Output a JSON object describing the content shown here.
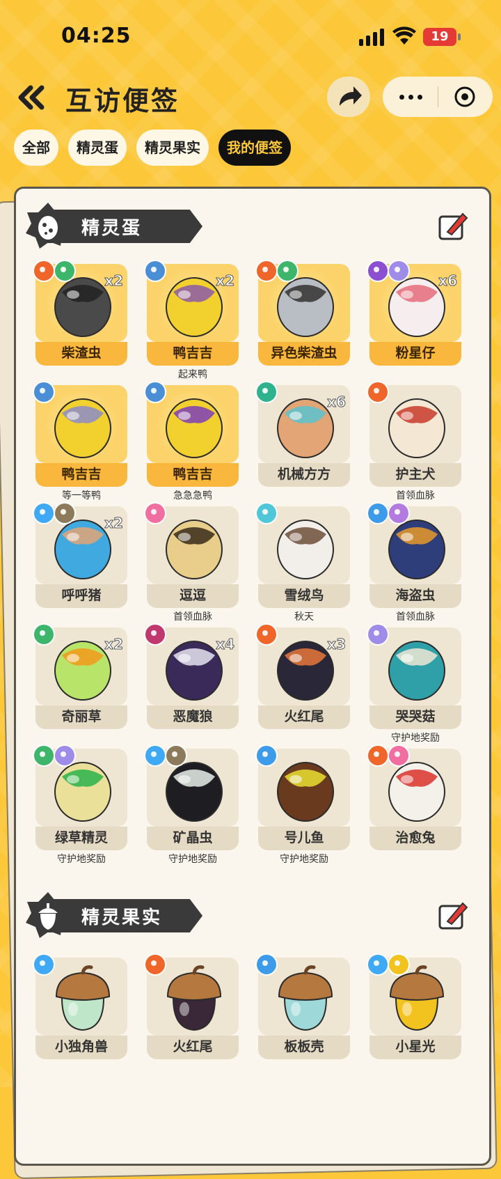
{
  "status": {
    "time": "04:25",
    "battery": "19"
  },
  "header": {
    "title": "互访便签"
  },
  "tabs": [
    {
      "label": "全部",
      "active": false
    },
    {
      "label": "精灵蛋",
      "active": false
    },
    {
      "label": "精灵果实",
      "active": false
    },
    {
      "label": "我的便签",
      "active": true
    }
  ],
  "eggs_section": {
    "title": "精灵蛋",
    "items": [
      {
        "name": "柴渣虫",
        "count": "x2",
        "sub": "",
        "gold": true,
        "badges": [
          "fire",
          "grass"
        ],
        "egg": [
          "#4a4a4a",
          "#222"
        ]
      },
      {
        "name": "鸭吉吉",
        "count": "x2",
        "sub": "起来鸭",
        "gold": true,
        "badges": [
          "normal"
        ],
        "egg": [
          "#F2D02E",
          "#8C5AA8"
        ]
      },
      {
        "name": "异色柴渣虫",
        "count": "",
        "sub": "",
        "gold": true,
        "badges": [
          "fire",
          "grass"
        ],
        "egg": [
          "#b9bec4",
          "#333"
        ]
      },
      {
        "name": "粉星仔",
        "count": "x6",
        "sub": "",
        "gold": true,
        "badges": [
          "ghost",
          "psychic"
        ],
        "egg": [
          "#F6EEEE",
          "#E56B7A"
        ]
      },
      {
        "name": "鸭吉吉",
        "count": "",
        "sub": "等一等鸭",
        "gold": true,
        "badges": [
          "normal"
        ],
        "egg": [
          "#F2D02E",
          "#8C8CC8"
        ]
      },
      {
        "name": "鸭吉吉",
        "count": "",
        "sub": "急急急鸭",
        "gold": true,
        "badges": [
          "normal"
        ],
        "egg": [
          "#F2D02E",
          "#7E3FB8"
        ]
      },
      {
        "name": "机械方方",
        "count": "x6",
        "sub": "",
        "gold": false,
        "badges": [
          "machine"
        ],
        "egg": [
          "#E3A575",
          "#5BC2CF"
        ]
      },
      {
        "name": "护主犬",
        "count": "",
        "sub": "首领血脉",
        "gold": false,
        "badges": [
          "fire"
        ],
        "egg": [
          "#F4E7D4",
          "#C93A2A"
        ]
      },
      {
        "name": "呼呼猪",
        "count": "x2",
        "sub": "",
        "gold": false,
        "badges": [
          "ice",
          "ground"
        ],
        "egg": [
          "#3FA9E0",
          "#E3A575"
        ]
      },
      {
        "name": "逗逗",
        "count": "",
        "sub": "首领血脉",
        "gold": false,
        "badges": [
          "fairy"
        ],
        "egg": [
          "#E8CE8A",
          "#3a2a1a"
        ]
      },
      {
        "name": "雪绒鸟",
        "count": "",
        "sub": "秋天",
        "gold": false,
        "badges": [
          "wind"
        ],
        "egg": [
          "#F2EFEA",
          "#6E4E3A"
        ]
      },
      {
        "name": "海盗虫",
        "count": "",
        "sub": "首领血脉",
        "gold": false,
        "badges": [
          "water",
          "psychic2"
        ],
        "egg": [
          "#2E3E7A",
          "#E89A2A"
        ]
      },
      {
        "name": "奇丽草",
        "count": "x2",
        "sub": "",
        "gold": false,
        "badges": [
          "grass"
        ],
        "egg": [
          "#B9E46A",
          "#F29A1A"
        ]
      },
      {
        "name": "恶魔狼",
        "count": "x4",
        "sub": "",
        "gold": false,
        "badges": [
          "dark"
        ],
        "egg": [
          "#3A2A5A",
          "#E8E4F0"
        ]
      },
      {
        "name": "火红尾",
        "count": "x3",
        "sub": "",
        "gold": false,
        "badges": [
          "fire"
        ],
        "egg": [
          "#2A2838",
          "#E8773A"
        ]
      },
      {
        "name": "哭哭菇",
        "count": "",
        "sub": "守护地奖励",
        "gold": false,
        "badges": [
          "psychic"
        ],
        "egg": [
          "#2FA0A8",
          "#EFE7D4"
        ]
      },
      {
        "name": "绿草精灵",
        "count": "",
        "sub": "守护地奖励",
        "gold": false,
        "badges": [
          "grass",
          "psychic"
        ],
        "egg": [
          "#EAE09A",
          "#2AB14A"
        ]
      },
      {
        "name": "矿晶虫",
        "count": "",
        "sub": "守护地奖励",
        "gold": false,
        "badges": [
          "ice",
          "ground"
        ],
        "egg": [
          "#1E1E22",
          "#E8EEE8"
        ]
      },
      {
        "name": "号儿鱼",
        "count": "",
        "sub": "守护地奖励",
        "gold": false,
        "badges": [
          "water"
        ],
        "egg": [
          "#6A3A1E",
          "#E8E030"
        ]
      },
      {
        "name": "治愈兔",
        "count": "",
        "sub": "",
        "gold": false,
        "badges": [
          "fire",
          "fairy"
        ],
        "egg": [
          "#F4F0EA",
          "#D8332A"
        ]
      }
    ]
  },
  "fruits_section": {
    "title": "精灵果实",
    "items": [
      {
        "name": "小独角兽",
        "badges": [
          "ice"
        ],
        "nut": "#BFE6C8"
      },
      {
        "name": "火红尾",
        "badges": [
          "fire"
        ],
        "nut": "#3A2838"
      },
      {
        "name": "板板壳",
        "badges": [
          "water"
        ],
        "nut": "#9FD8D8"
      },
      {
        "name": "小星光",
        "badges": [
          "ice",
          "electric"
        ],
        "nut": "#F2C21E"
      }
    ]
  },
  "colors": {
    "fire": "#F0652A",
    "grass": "#3DB56B",
    "normal": "#4A8FD6",
    "ghost": "#8B4FD1",
    "psychic": "#9E8CE8",
    "psychic2": "#B37AE0",
    "machine": "#2FB38E",
    "ice": "#3FA9F5",
    "ground": "#8C7A5A",
    "fairy": "#F06FA0",
    "wind": "#4FC7D8",
    "water": "#3D9BE9",
    "dark": "#C0386E",
    "electric": "#F2C21E"
  }
}
